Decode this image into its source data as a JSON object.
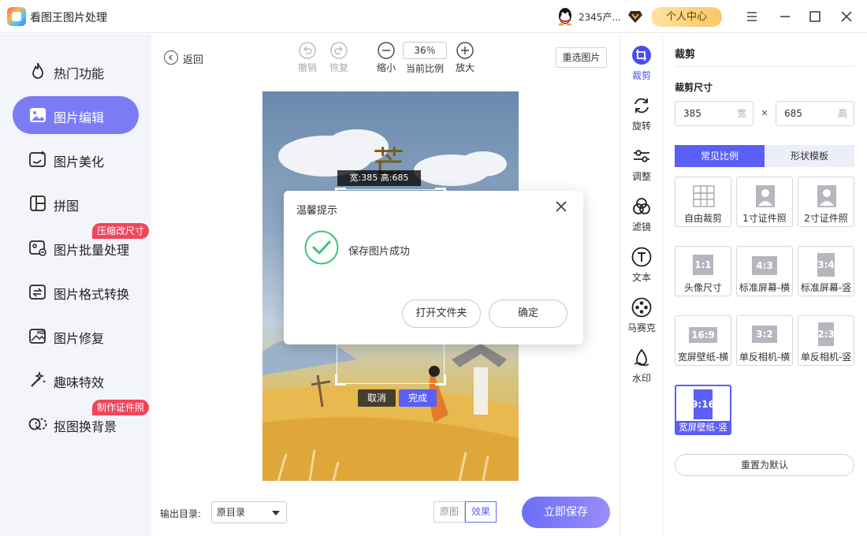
{
  "app": {
    "title": "看图王图片处理"
  },
  "titlebar": {
    "username": "2345产...",
    "personal_center": "个人中心"
  },
  "sidebar": {
    "items": [
      {
        "label": "热门功能"
      },
      {
        "label": "图片编辑"
      },
      {
        "label": "图片美化"
      },
      {
        "label": "拼图"
      },
      {
        "label": "图片批量处理",
        "badge": "压缩改尺寸"
      },
      {
        "label": "图片格式转换"
      },
      {
        "label": "图片修复"
      },
      {
        "label": "趣味特效"
      },
      {
        "label": "抠图换背景",
        "badge": "制作证件照"
      }
    ]
  },
  "toolbar": {
    "back": "返回",
    "undo": "撤销",
    "redo": "恢复",
    "zoom_out": "缩小",
    "zoom_value": "36％",
    "zoom_caption": "当前比例",
    "zoom_in": "放大",
    "reselect": "重选图片"
  },
  "canvas": {
    "crop_size_label": "宽:385  高:685",
    "crop_cancel": "取消",
    "crop_done": "完成",
    "title_char": "芒"
  },
  "bottom": {
    "output_label": "输出目录:",
    "output_value": "原目录",
    "view_original": "原图",
    "view_effect": "效果",
    "save": "立即保存"
  },
  "tools": [
    {
      "label": "裁剪",
      "icon": "crop-icon"
    },
    {
      "label": "旋转",
      "icon": "rotate-icon"
    },
    {
      "label": "调整",
      "icon": "adjust-icon"
    },
    {
      "label": "滤镜",
      "icon": "filter-icon"
    },
    {
      "label": "文本",
      "icon": "text-icon"
    },
    {
      "label": "马赛克",
      "icon": "mosaic-icon"
    },
    {
      "label": "水印",
      "icon": "watermark-icon"
    }
  ],
  "panel": {
    "title": "裁剪",
    "size_title": "裁剪尺寸",
    "width_value": "385",
    "width_unit": "宽",
    "height_value": "685",
    "height_unit": "高",
    "times": "×",
    "tab_common": "常见比例",
    "tab_shape": "形状模板",
    "ratios": [
      {
        "thumb": "",
        "label": "自由裁剪"
      },
      {
        "thumb": "",
        "label": "1寸证件照"
      },
      {
        "thumb": "",
        "label": "2寸证件照"
      },
      {
        "thumb": "1:1",
        "label": "头像尺寸"
      },
      {
        "thumb": "4:3",
        "label": "标准屏幕-横"
      },
      {
        "thumb": "3:4",
        "label": "标准屏幕-竖"
      },
      {
        "thumb": "16:9",
        "label": "宽屏壁纸-横"
      },
      {
        "thumb": "3:2",
        "label": "单反相机-横"
      },
      {
        "thumb": "2:3",
        "label": "单反相机-竖"
      },
      {
        "thumb": "9:16",
        "label": "宽屏壁纸-竖"
      }
    ],
    "reset": "重置为默认"
  },
  "dialog": {
    "title": "温馨提示",
    "message": "保存图片成功",
    "open_folder": "打开文件夹",
    "ok": "确定"
  },
  "colors": {
    "accent": "#5b5ff5",
    "sidebar_active": "#7b7cf5",
    "badge": "#f0455c",
    "success": "#3cc47c"
  }
}
